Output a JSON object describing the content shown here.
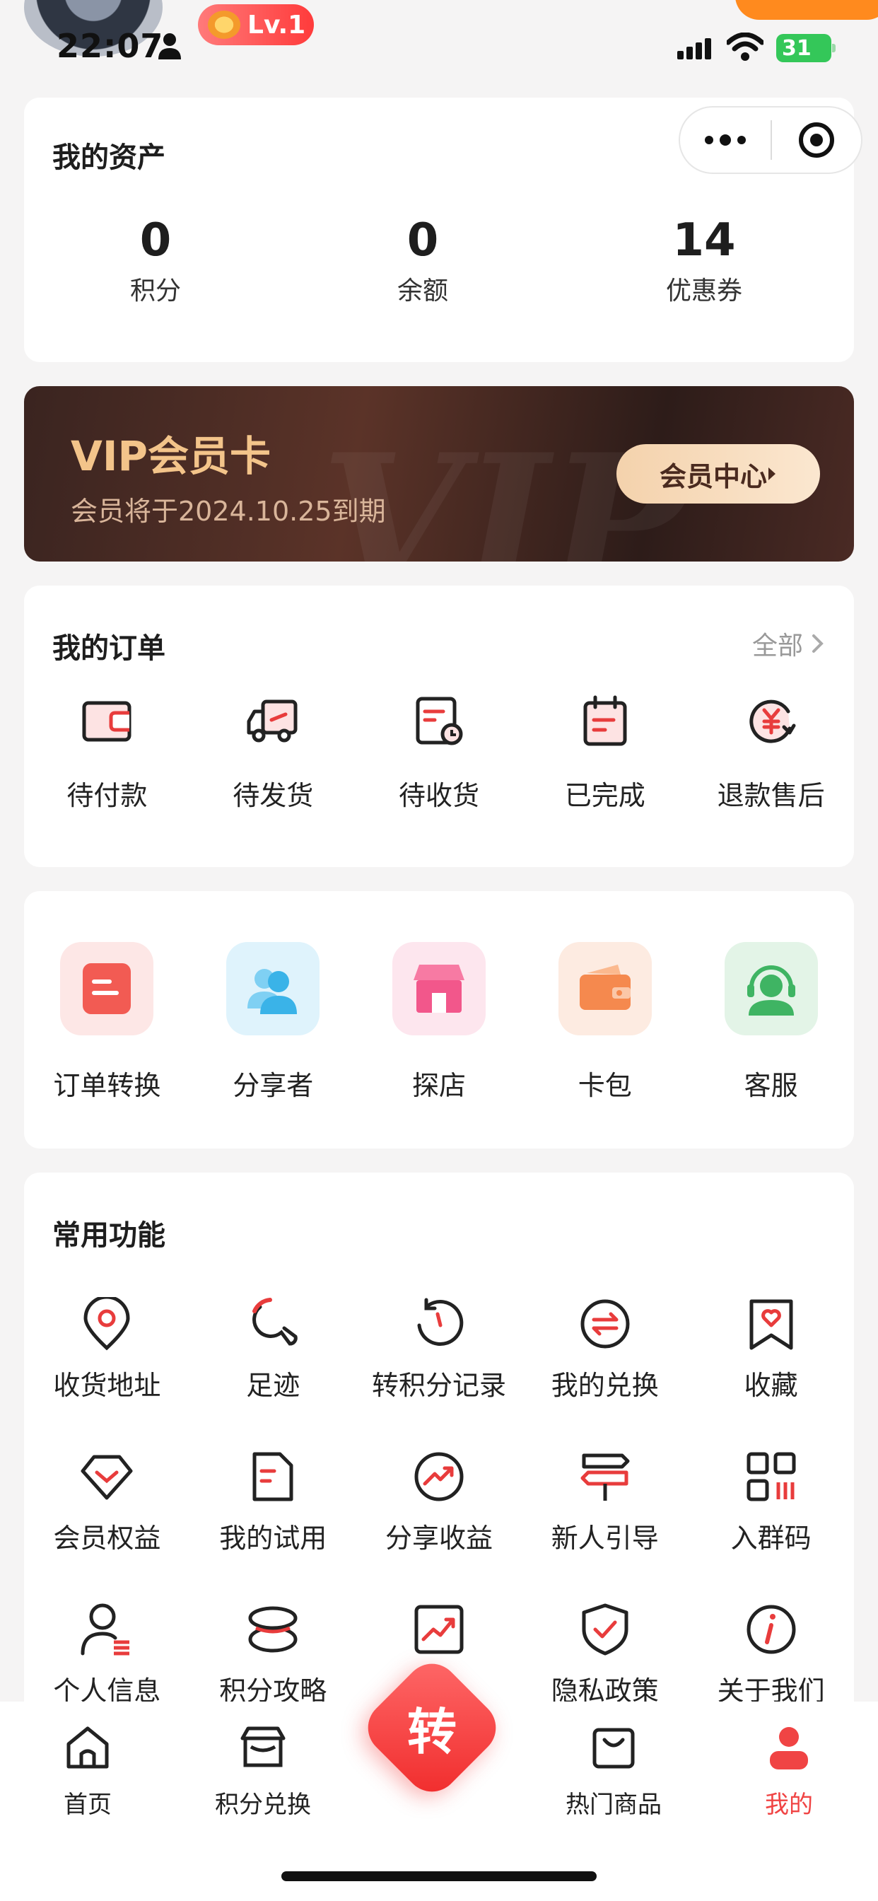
{
  "status_bar": {
    "time": "22:07",
    "level_badge": "Lv.1",
    "battery": "31"
  },
  "assets": {
    "title": "我的资产",
    "items": [
      {
        "value": "0",
        "label": "积分"
      },
      {
        "value": "0",
        "label": "余额"
      },
      {
        "value": "14",
        "label": "优惠券"
      }
    ]
  },
  "vip": {
    "title": "VIP会员卡",
    "subtitle": "会员将于2024.10.25到期",
    "button": "会员中心",
    "watermark": "VIP"
  },
  "orders": {
    "title": "我的订单",
    "all_link": "全部",
    "items": [
      {
        "label": "待付款",
        "icon": "pending-payment-icon"
      },
      {
        "label": "待发货",
        "icon": "pending-shipment-icon"
      },
      {
        "label": "待收货",
        "icon": "pending-receipt-icon"
      },
      {
        "label": "已完成",
        "icon": "completed-icon"
      },
      {
        "label": "退款售后",
        "icon": "refund-icon"
      }
    ]
  },
  "services": {
    "items": [
      {
        "label": "订单转换",
        "icon": "order-convert-icon",
        "bg": "#fde7e6",
        "color": "#f25b53"
      },
      {
        "label": "分享者",
        "icon": "sharer-icon",
        "bg": "#dff3fc",
        "color": "#3ab3e8"
      },
      {
        "label": "探店",
        "icon": "store-icon",
        "bg": "#fde6ee",
        "color": "#f2578b"
      },
      {
        "label": "卡包",
        "icon": "wallet-icon",
        "bg": "#fdebe1",
        "color": "#f5894e"
      },
      {
        "label": "客服",
        "icon": "customer-service-icon",
        "bg": "#e3f4e7",
        "color": "#3fb463"
      }
    ]
  },
  "common": {
    "title": "常用功能",
    "rows": [
      [
        {
          "label": "收货地址",
          "icon": "location-icon"
        },
        {
          "label": "足迹",
          "icon": "footprint-icon"
        },
        {
          "label": "转积分记录",
          "icon": "history-icon"
        },
        {
          "label": "我的兑换",
          "icon": "exchange-icon"
        },
        {
          "label": "收藏",
          "icon": "favorite-icon"
        }
      ],
      [
        {
          "label": "会员权益",
          "icon": "diamond-icon"
        },
        {
          "label": "我的试用",
          "icon": "trial-icon"
        },
        {
          "label": "分享收益",
          "icon": "earnings-icon"
        },
        {
          "label": "新人引导",
          "icon": "signpost-icon"
        },
        {
          "label": "入群码",
          "icon": "qrcode-icon"
        }
      ],
      [
        {
          "label": "个人信息",
          "icon": "profile-icon"
        },
        {
          "label": "积分攻略",
          "icon": "strategy-icon"
        },
        {
          "label": "",
          "icon": "trend-icon"
        },
        {
          "label": "隐私政策",
          "icon": "privacy-icon"
        },
        {
          "label": "关于我们",
          "icon": "about-icon"
        }
      ]
    ]
  },
  "nav": {
    "items": [
      {
        "label": "首页",
        "icon": "home-icon"
      },
      {
        "label": "积分兑换",
        "icon": "points-exchange-icon"
      },
      {
        "label": "热门商品",
        "icon": "hot-goods-icon"
      },
      {
        "label": "我的",
        "icon": "me-icon"
      }
    ],
    "center": "转"
  },
  "colors": {
    "accent": "#f04444",
    "vip_gold": "#f3c48a"
  }
}
